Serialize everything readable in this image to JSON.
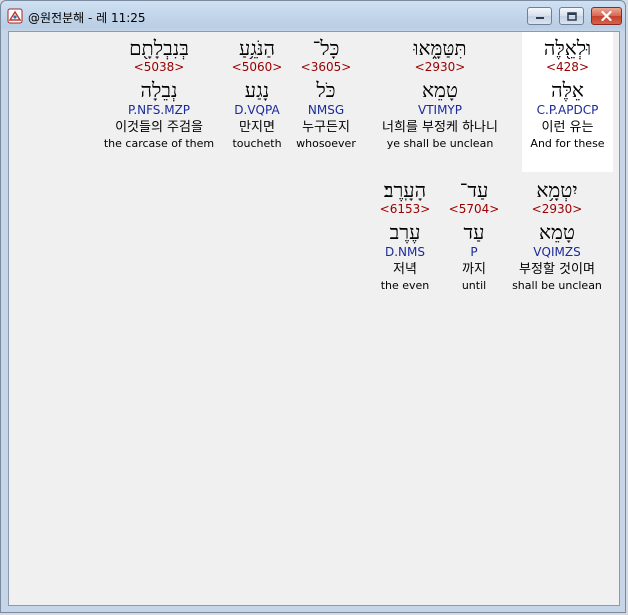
{
  "window": {
    "title": "@원전분해 - 레 11:25"
  },
  "titlebar_buttons": {
    "minimize": "minimize-icon",
    "maximize": "maximize-icon",
    "close": "close-icon",
    "close_color": "#c6402a"
  },
  "row1": [
    {
      "hebrew": "וּלְאֵ֖לֶּה",
      "strong": "<428>",
      "lemma": "אֵלֶּה",
      "parse": "C.P.APDCP",
      "korean": "이런 유는",
      "english": "And for these",
      "highlighted": true
    },
    {
      "hebrew": "תִּטַּמָּ֑אוּ",
      "strong": "<2930>",
      "lemma": "טָמֵא",
      "parse": "VTIMYP",
      "korean": "너희를 부정케 하나니",
      "english": "ye shall be unclean",
      "highlighted": false
    },
    {
      "hebrew": "כָּל־",
      "strong": "<3605>",
      "lemma": "כֹּל",
      "parse": "NMSG",
      "korean": "누구든지",
      "english": "whosoever",
      "highlighted": false
    },
    {
      "hebrew": "הַנֹּגֵ֥עַ",
      "strong": "<5060>",
      "lemma": "נָגַע",
      "parse": "D.VQPA",
      "korean": "만지면",
      "english": "toucheth",
      "highlighted": false
    },
    {
      "hebrew": "בְּנִבְלָתָ֖ם",
      "strong": "<5038>",
      "lemma": "נְבֵלָה",
      "parse": "P.NFS.MZP",
      "korean": "이것들의 주검을",
      "english": "the carcase of them",
      "highlighted": false
    }
  ],
  "row2": [
    {
      "hebrew": "יִטְמָ֥א",
      "strong": "<2930>",
      "lemma": "טָמֵא",
      "parse": "VQIMZS",
      "korean": "부정할 것이며",
      "english": "shall be unclean"
    },
    {
      "hebrew": "עַד־",
      "strong": "<5704>",
      "lemma": "עַד",
      "parse": "P",
      "korean": "까지",
      "english": "until"
    },
    {
      "hebrew": "הָעָֽרֶב׃",
      "strong": "<6153>",
      "lemma": "עֶרֶב",
      "parse": "D.NMS",
      "korean": "저녁",
      "english": "the even"
    }
  ],
  "colors": {
    "strong_number": "#990000",
    "parse_code": "#1a2a9a",
    "highlight_bg": "#ffffff"
  }
}
